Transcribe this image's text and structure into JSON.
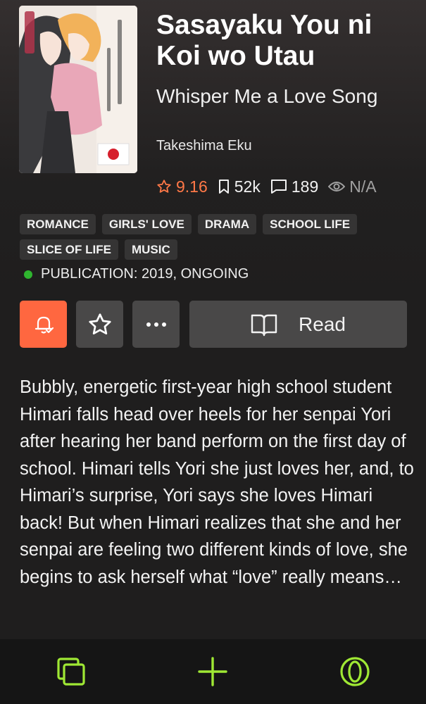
{
  "manga": {
    "title": "Sasayaku You ni Koi wo Utau",
    "alt_title": "Whisper Me a Love Song",
    "author": "Takeshima Eku",
    "cover_flag_icon": "japan-flag-icon"
  },
  "stats": {
    "rating": "9.16",
    "follows": "52k",
    "comments": "189",
    "views": "N/A"
  },
  "tags": [
    "ROMANCE",
    "GIRLS' LOVE",
    "DRAMA",
    "SCHOOL LIFE",
    "SLICE OF LIFE",
    "MUSIC"
  ],
  "publication": {
    "text": "PUBLICATION: 2019, ONGOING",
    "status_color": "#2fb52f"
  },
  "actions": {
    "read_label": "Read",
    "accent_color": "#ff6740"
  },
  "description": "Bubbly, energetic first-year high school student Himari falls head over heels for her senpai Yori after hearing her band perform on the first day of school. Himari tells Yori she just loves her, and, to Himari’s surprise, Yori says she loves Himari back! But when Himari realizes that she and her senpai are feeling two different kinds of love, she begins to ask herself what “love” really means…",
  "bottom_nav": {
    "icons": [
      "copy-icon",
      "plus-icon",
      "opera-icon"
    ],
    "icon_color": "#9fe834"
  }
}
